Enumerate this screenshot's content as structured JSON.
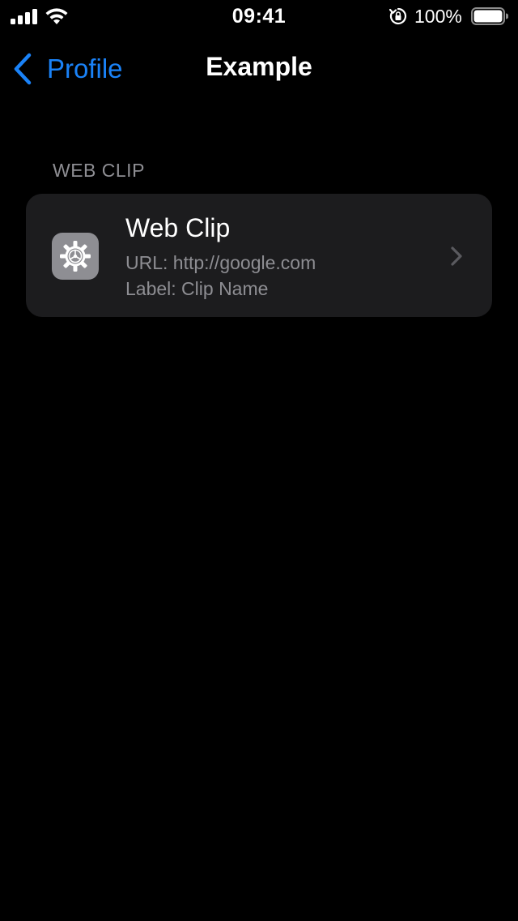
{
  "status_bar": {
    "time": "09:41",
    "battery_percent": "100%",
    "battery_level": 1.0
  },
  "nav": {
    "back_label": "Profile",
    "title": "Example"
  },
  "section": {
    "header": "WEB CLIP"
  },
  "row": {
    "title": "Web Clip",
    "url": "URL: http://google.com",
    "label": "Label: Clip Name",
    "icon": "settings-gear-icon"
  },
  "colors": {
    "background": "#000000",
    "accent": "#1a82f7",
    "cell_background": "#1c1c1e",
    "secondary_text": "#8e8e93"
  }
}
